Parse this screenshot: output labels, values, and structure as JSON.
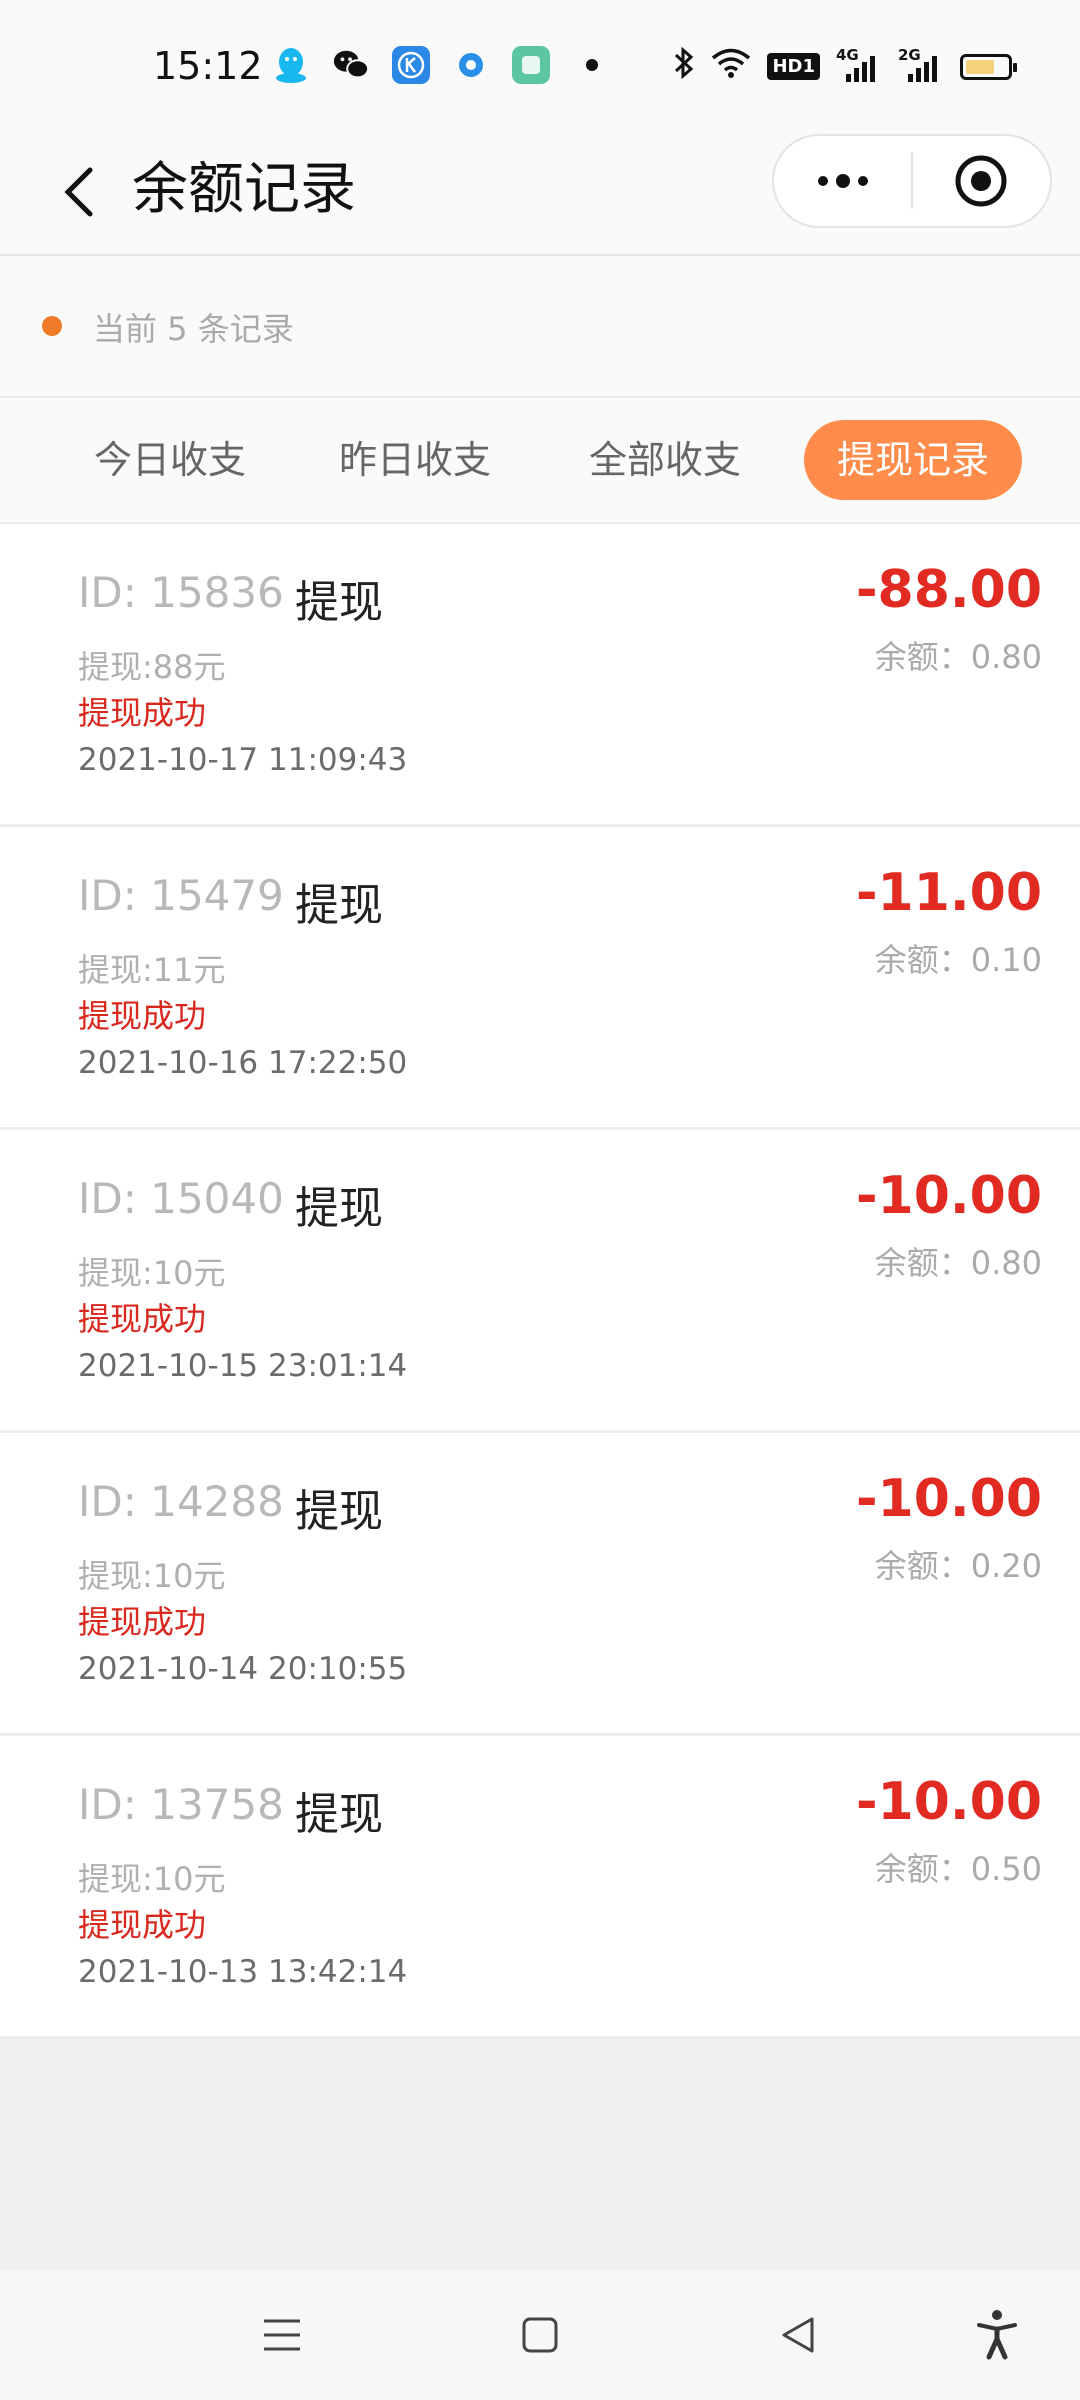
{
  "status_bar": {
    "time": "15:12",
    "icons": [
      "qq-icon",
      "wechat-icon",
      "k-app-icon",
      "browser-icon",
      "app-icon",
      "dot-icon",
      "bluetooth-icon",
      "wifi-icon",
      "hd-icon",
      "4g-signal-icon",
      "2g-signal-icon",
      "battery-icon"
    ],
    "hd_label": "HD1",
    "net1_label": "4G",
    "net2_label": "2G",
    "battery_color": "#f3d27a"
  },
  "header": {
    "title": "余额记录",
    "more_icon": "more-icon",
    "close_icon": "target-icon"
  },
  "summary": {
    "count_text": "当前 5 条记录",
    "dot_color": "#f07c2a"
  },
  "tabs": [
    {
      "label": "今日收支",
      "active": false
    },
    {
      "label": "昨日收支",
      "active": false
    },
    {
      "label": "全部收支",
      "active": false
    },
    {
      "label": "提现记录",
      "active": true
    }
  ],
  "accent_color": "#ff8c4a",
  "records": [
    {
      "id": "ID: 15836",
      "type": "提现",
      "desc": "提现:88元",
      "status": "提现成功",
      "time": "2021-10-17 11:09:43",
      "amount": "-88.00",
      "balance": "余额：0.80"
    },
    {
      "id": "ID: 15479",
      "type": "提现",
      "desc": "提现:11元",
      "status": "提现成功",
      "time": "2021-10-16 17:22:50",
      "amount": "-11.00",
      "balance": "余额：0.10"
    },
    {
      "id": "ID: 15040",
      "type": "提现",
      "desc": "提现:10元",
      "status": "提现成功",
      "time": "2021-10-15 23:01:14",
      "amount": "-10.00",
      "balance": "余额：0.80"
    },
    {
      "id": "ID: 14288",
      "type": "提现",
      "desc": "提现:10元",
      "status": "提现成功",
      "time": "2021-10-14 20:10:55",
      "amount": "-10.00",
      "balance": "余额：0.20"
    },
    {
      "id": "ID: 13758",
      "type": "提现",
      "desc": "提现:10元",
      "status": "提现成功",
      "time": "2021-10-13 13:42:14",
      "amount": "-10.00",
      "balance": "余额：0.50"
    }
  ],
  "nav_bar": {
    "icons": [
      "menu-icon",
      "home-icon",
      "back-icon",
      "accessibility-icon"
    ]
  }
}
